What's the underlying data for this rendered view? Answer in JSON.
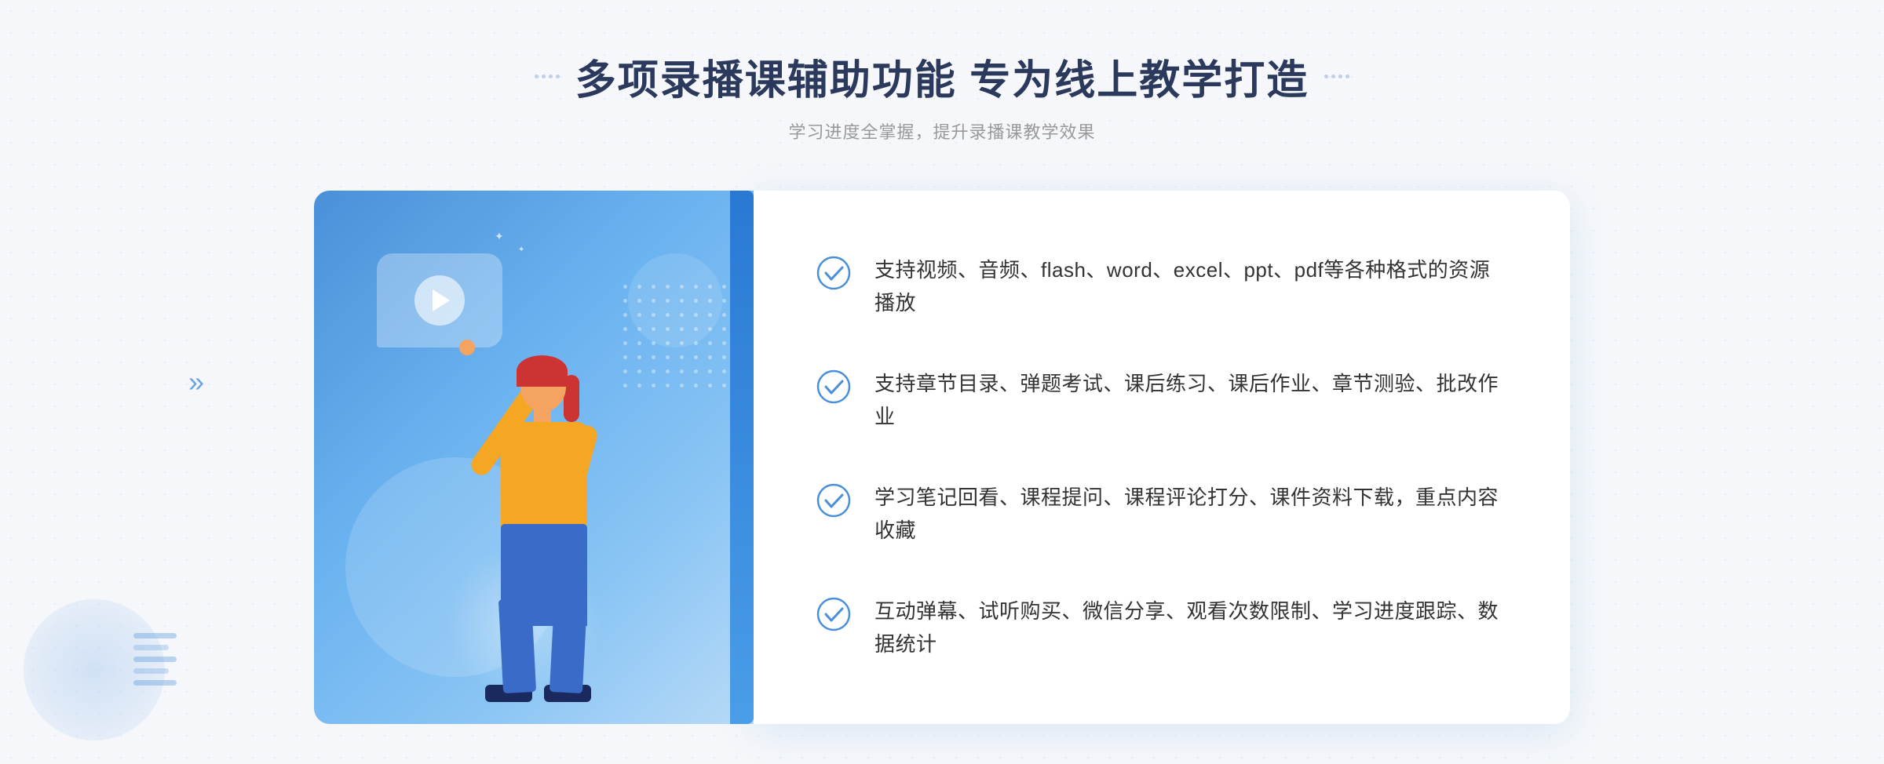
{
  "page": {
    "background_color": "#f5f7fa"
  },
  "header": {
    "title": "多项录播课辅助功能 专为线上教学打造",
    "subtitle": "学习进度全掌握，提升录播课教学效果"
  },
  "features": [
    {
      "id": "feature-1",
      "text": "支持视频、音频、flash、word、excel、ppt、pdf等各种格式的资源播放"
    },
    {
      "id": "feature-2",
      "text": "支持章节目录、弹题考试、课后练习、课后作业、章节测验、批改作业"
    },
    {
      "id": "feature-3",
      "text": "学习笔记回看、课程提问、课程评论打分、课件资料下载，重点内容收藏"
    },
    {
      "id": "feature-4",
      "text": "互动弹幕、试听购买、微信分享、观看次数限制、学习进度跟踪、数据统计"
    }
  ],
  "icons": {
    "check_circle": "✓",
    "chevron_left": "《",
    "play": "▶"
  }
}
